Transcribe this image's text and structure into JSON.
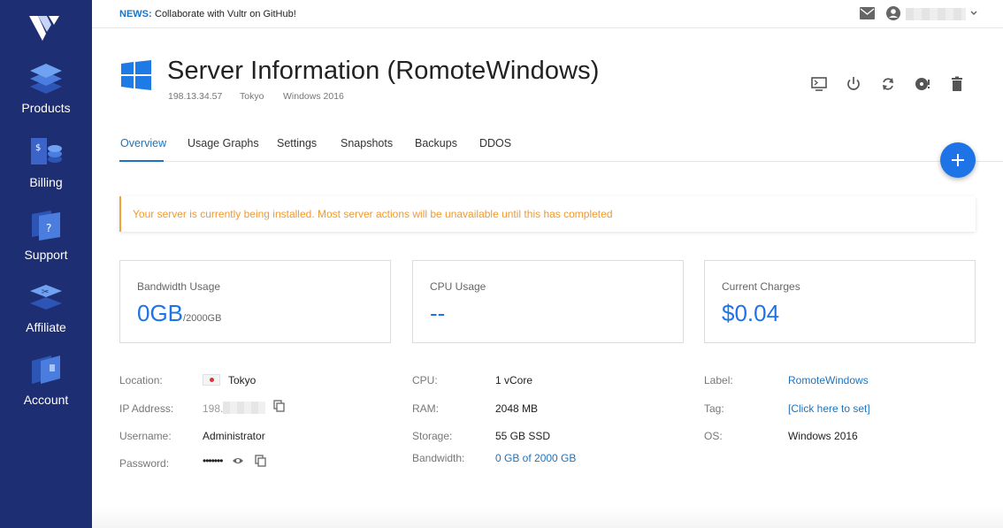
{
  "sidebar": {
    "items": [
      {
        "label": "Products",
        "icon": "products-layers-icon"
      },
      {
        "label": "Billing",
        "icon": "billing-coins-icon"
      },
      {
        "label": "Support",
        "icon": "support-help-icon"
      },
      {
        "label": "Affiliate",
        "icon": "affiliate-icon"
      },
      {
        "label": "Account",
        "icon": "account-icon"
      }
    ],
    "color": "#1e2e73"
  },
  "topbar": {
    "news_tag": "NEWS:",
    "news_text": "Collaborate with Vultr on GitHub!"
  },
  "header": {
    "title": "Server Information (RomoteWindows)",
    "ip": "198.13.34.57",
    "location": "Tokyo",
    "os": "Windows 2016"
  },
  "tabs": [
    {
      "label": "Overview",
      "active": true
    },
    {
      "label": "Usage Graphs",
      "active": false
    },
    {
      "label": "Settings",
      "active": false
    },
    {
      "label": "Snapshots",
      "active": false
    },
    {
      "label": "Backups",
      "active": false
    },
    {
      "label": "DDOS",
      "active": false
    }
  ],
  "alert": {
    "text": "Your server is currently being installed. Most server actions will be unavailable until this has completed",
    "color": "#ef9a2f"
  },
  "cards": {
    "bandwidth": {
      "title": "Bandwidth Usage",
      "value": "0GB",
      "unit": "/2000GB"
    },
    "cpu": {
      "title": "CPU Usage",
      "value": "--"
    },
    "charges": {
      "title": "Current Charges",
      "value": "$0.04"
    }
  },
  "details": {
    "location_label": "Location:",
    "location_value": "Tokyo",
    "ip_label": "IP Address:",
    "ip_value": "198.",
    "username_label": "Username:",
    "username_value": "Administrator",
    "password_label": "Password:",
    "password_value": "•••••••",
    "cpu_label": "CPU:",
    "cpu_value": "1 vCore",
    "ram_label": "RAM:",
    "ram_value": "2048 MB",
    "storage_label": "Storage:",
    "storage_value": "55 GB SSD",
    "bandwidth_label": "Bandwidth:",
    "bandwidth_value": "0 GB of 2000 GB",
    "label_label": "Label:",
    "label_value": "RomoteWindows",
    "tag_label": "Tag:",
    "tag_value": "[Click here to set]",
    "os_label": "OS:",
    "os_value": "Windows 2016"
  },
  "colors": {
    "accent": "#1e73e6",
    "link": "#1e73be",
    "warning": "#ef9a2f"
  }
}
